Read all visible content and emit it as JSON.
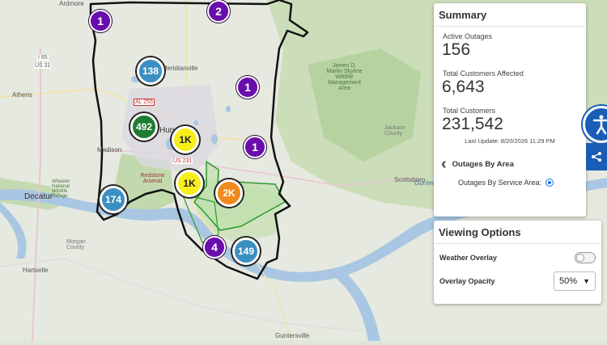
{
  "map": {
    "clusters": [
      {
        "label": "1",
        "kind": "purple"
      },
      {
        "label": "2",
        "kind": "purple"
      },
      {
        "label": "138",
        "kind": "blue"
      },
      {
        "label": "1",
        "kind": "purple"
      },
      {
        "label": "492",
        "kind": "green"
      },
      {
        "label": "1K",
        "kind": "yellow"
      },
      {
        "label": "1",
        "kind": "purple"
      },
      {
        "label": "1K",
        "kind": "yellow"
      },
      {
        "label": "2K",
        "kind": "orange"
      },
      {
        "label": "174",
        "kind": "blue"
      },
      {
        "label": "4",
        "kind": "purple"
      },
      {
        "label": "149",
        "kind": "blue"
      }
    ],
    "place_labels": {
      "ardmore": "Ardmore",
      "athens": "Athens",
      "i65": "I 65",
      "us31": "US 31",
      "meridianville": "Meridianville",
      "al255": "AL 255",
      "huntsville": "Hun",
      "madison": "Madison",
      "us231": "US 231",
      "redstone": "Redstone Arsenal",
      "decatur": "Decatur",
      "wheeler": "Wheeler National Wildlife Refuge",
      "morgan": "Morgan County",
      "hartselle": "Hartselle",
      "guntersville": "Guntersville",
      "scottsboro": "Scottsboro",
      "jackson": "Jackson County",
      "skyline": "James D. Martin Skyline Wildlife Management Area",
      "gunter": "Gunter"
    }
  },
  "summary": {
    "title": "Summary",
    "active_outages_label": "Active Outages",
    "active_outages": "156",
    "total_affected_label": "Total Customers Affected",
    "total_affected": "6,643",
    "total_customers_label": "Total Customers",
    "total_customers": "231,542",
    "last_update": "Last Update: 8/20/2026 11:29 PM",
    "outages_by_area": "Outages By Area",
    "service_area_label": "Outages By Service Area:"
  },
  "viewing": {
    "title": "Viewing Options",
    "weather_overlay": "Weather Overlay",
    "overlay_opacity": "Overlay Opacity",
    "opacity_value": "50%"
  },
  "icons": {
    "accessibility": "accessibility-icon",
    "share": "share-icon",
    "back": "chevron-left-icon"
  },
  "colors": {
    "purple": "#6a0dad",
    "blue": "#3b8fc2",
    "green": "#1e7d32",
    "yellow": "#f6ef1a",
    "orange": "#f08a1c",
    "accent": "#1a5db6"
  }
}
